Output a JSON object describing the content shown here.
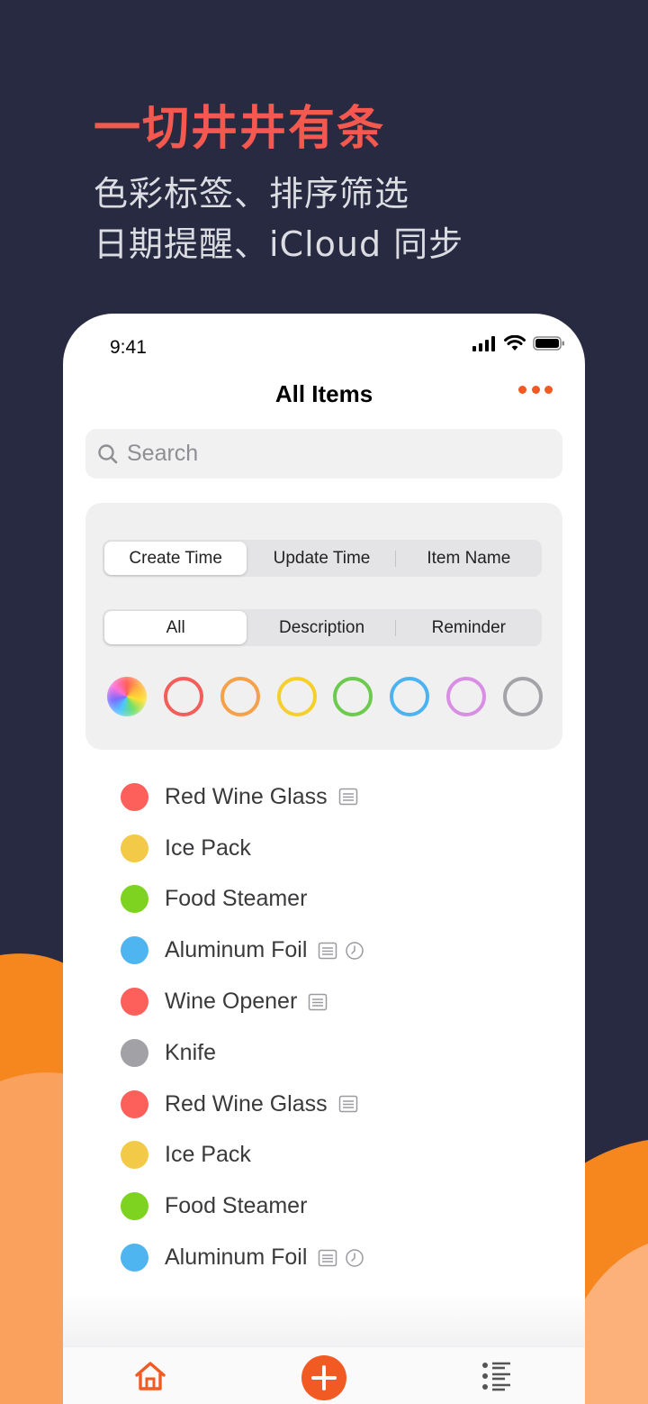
{
  "promo": {
    "headline": "一切井井有条",
    "line1": "色彩标签、排序筛选",
    "line2": "日期提醒、iCloud 同步"
  },
  "status": {
    "time": "9:41"
  },
  "nav": {
    "title": "All Items",
    "more_icon": "more-icon"
  },
  "search": {
    "placeholder": "Search",
    "icon": "search-icon"
  },
  "sort_segment": {
    "options": [
      "Create Time",
      "Update Time",
      "Item Name"
    ],
    "selected": "Create Time"
  },
  "filter_segment": {
    "options": [
      "All",
      "Description",
      "Reminder"
    ],
    "selected": "All"
  },
  "color_filters": [
    "all",
    "#f25e5a",
    "#f5a04a",
    "#f6cf2a",
    "#6ccb4f",
    "#4cb3f2",
    "#d88ee3",
    "#a3a3a8"
  ],
  "colors": {
    "accent": "#f15a22",
    "background": "#272a41",
    "headline": "#f4584f"
  },
  "items": [
    {
      "label": "Red Wine Glass",
      "color": "#fd605b",
      "note": true,
      "reminder": false
    },
    {
      "label": "Ice Pack",
      "color": "#f3c948",
      "note": false,
      "reminder": false
    },
    {
      "label": "Food Steamer",
      "color": "#7ed321",
      "note": false,
      "reminder": false
    },
    {
      "label": "Aluminum Foil",
      "color": "#4fb5f0",
      "note": true,
      "reminder": true
    },
    {
      "label": "Wine Opener",
      "color": "#fd605b",
      "note": true,
      "reminder": false
    },
    {
      "label": "Knife",
      "color": "#a1a1a6",
      "note": false,
      "reminder": false
    },
    {
      "label": "Red Wine Glass",
      "color": "#fd605b",
      "note": true,
      "reminder": false
    },
    {
      "label": "Ice Pack",
      "color": "#f3c948",
      "note": false,
      "reminder": false
    },
    {
      "label": "Food Steamer",
      "color": "#7ed321",
      "note": false,
      "reminder": false
    },
    {
      "label": "Aluminum Foil",
      "color": "#4fb5f0",
      "note": true,
      "reminder": true
    }
  ],
  "tabbar": [
    "home-icon",
    "add-icon",
    "list-icon"
  ]
}
